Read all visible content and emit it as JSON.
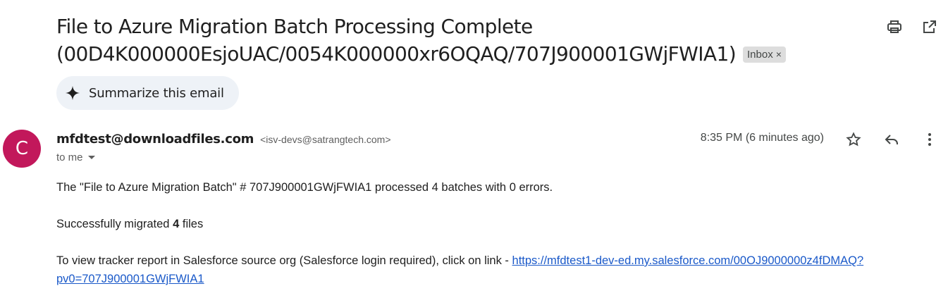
{
  "email": {
    "subject": "File to Azure Migration Batch Processing Complete (00D4K000000EsjoUAC/0054K000000xr6OQAQ/707J900001GWjFWIA1)",
    "label_chip": "Inbox",
    "label_chip_remove": "×",
    "summarize_label": "Summarize this email",
    "sender": {
      "avatar_letter": "C",
      "name": "mfdtest@downloadfiles.com",
      "email": "<isv-devs@satrangtech.com>",
      "recipients": "to me",
      "time": "8:35 PM (6 minutes ago)"
    },
    "body": {
      "line1": "The \"File to Azure Migration Batch\" # 707J900001GWjFWIA1 processed 4 batches with 0 errors.",
      "line2_prefix": "Successfully migrated",
      "line2_count": "4",
      "line2_suffix": "files",
      "line3_prefix": "To view tracker report in Salesforce source org (Salesforce login required), click on link -",
      "link": "https://mfdtest1-dev-ed.my.salesforce.com/00OJ9000000z4fDMAQ?pv0=707J900001GWjFWIA1"
    }
  },
  "icons": {
    "top": [
      "print-icon",
      "open-in-new-window-icon"
    ],
    "message": [
      "star-icon",
      "reply-icon",
      "more-vert-icon"
    ],
    "summarize": "sparkle-icon"
  },
  "colors": {
    "avatar": "#c2185b",
    "link": "#1a59c9",
    "summarize_bg": "#eef2f7",
    "chip_bg": "#dddddd"
  }
}
